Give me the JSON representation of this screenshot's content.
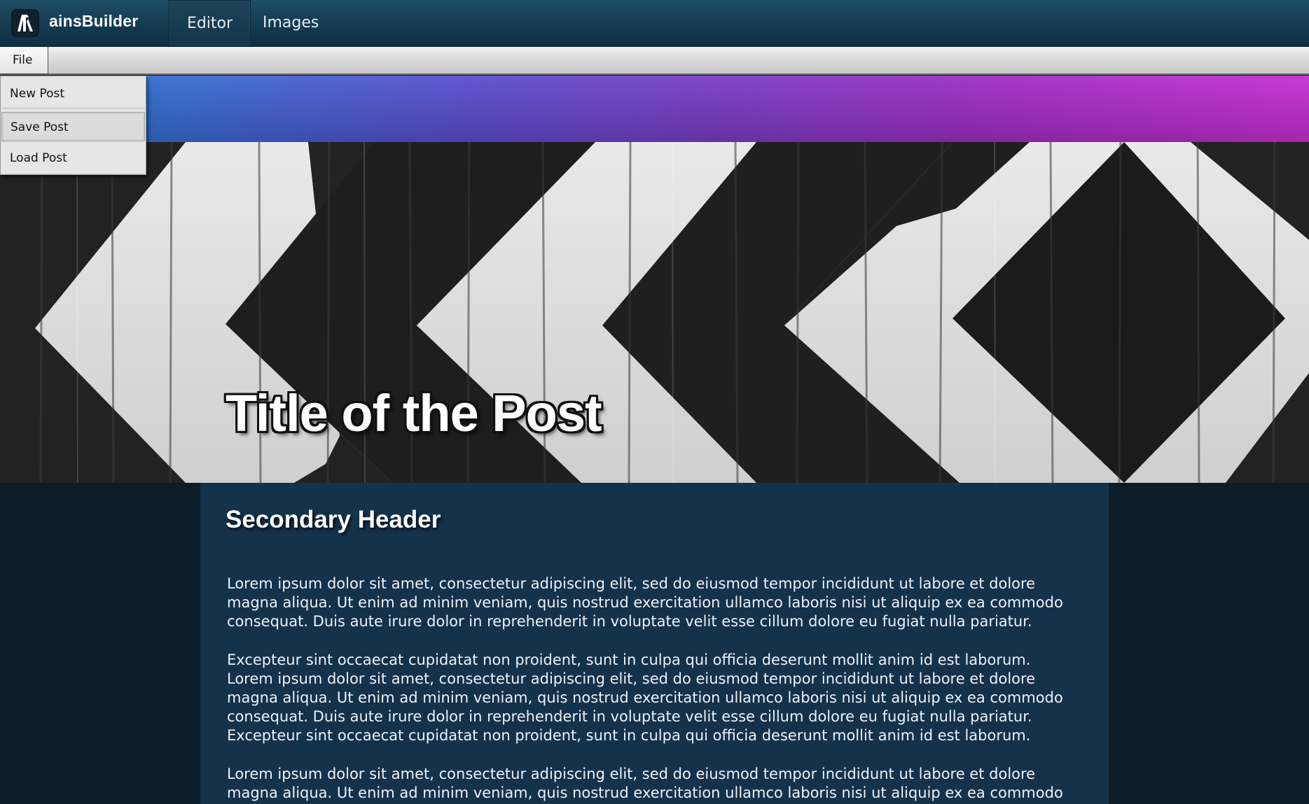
{
  "app": {
    "name": "ainsBuilder",
    "logo_icon": "a-logo-icon"
  },
  "nav": {
    "tabs": [
      {
        "label": "Editor",
        "active": true
      },
      {
        "label": "Images",
        "active": false
      }
    ]
  },
  "menubar": {
    "file_label": "File"
  },
  "file_menu": {
    "items": [
      {
        "label": "New Post"
      },
      {
        "label": "Save Post"
      },
      {
        "label": "Load Post"
      }
    ]
  },
  "banner": {
    "gradient_start": "#1d78c9",
    "gradient_end": "#c72fd2"
  },
  "hero": {
    "title": "Title of the Post",
    "image_desc_icon": "chevron-pattern-image"
  },
  "content": {
    "secondary_header": "Secondary Header",
    "paragraphs": [
      {
        "lines": [
          "Lorem ipsum dolor sit amet, consectetur adipiscing elit, sed do eiusmod tempor incididunt ut labore et dolore",
          "magna aliqua. Ut enim ad minim  veniam, quis nostrud exercitation ullamco laboris nisi ut aliquip ex ea  commodo",
          "consequat. Duis aute irure dolor in reprehenderit in voluptate  velit esse cillum dolore eu fugiat nulla pariatur."
        ]
      },
      {
        "lines": [
          "Excepteur sint  occaecat cupidatat non proident, sunt in culpa qui officia deserunt  mollit anim id est laborum.",
          "Lorem ipsum dolor sit amet, consectetur adipiscing elit, sed do eiusmod tempor incididunt ut labore et dolore",
          "magna aliqua. Ut enim ad minim  veniam, quis nostrud exercitation ullamco laboris nisi ut aliquip ex ea  commodo",
          "consequat. Duis aute irure dolor in reprehenderit in voluptate  velit esse cillum dolore eu fugiat nulla pariatur.",
          "Excepteur sint  occaecat cupidatat non proident, sunt in culpa qui officia deserunt  mollit anim id est laborum."
        ]
      },
      {
        "lines": [
          "Lorem ipsum dolor sit amet, consectetur adipiscing elit, sed do eiusmod tempor incididunt ut labore et dolore",
          "magna aliqua. Ut enim ad minim  veniam, quis nostrud exercitation ullamco laboris nisi ut aliquip ex ea  commodo"
        ]
      }
    ]
  }
}
